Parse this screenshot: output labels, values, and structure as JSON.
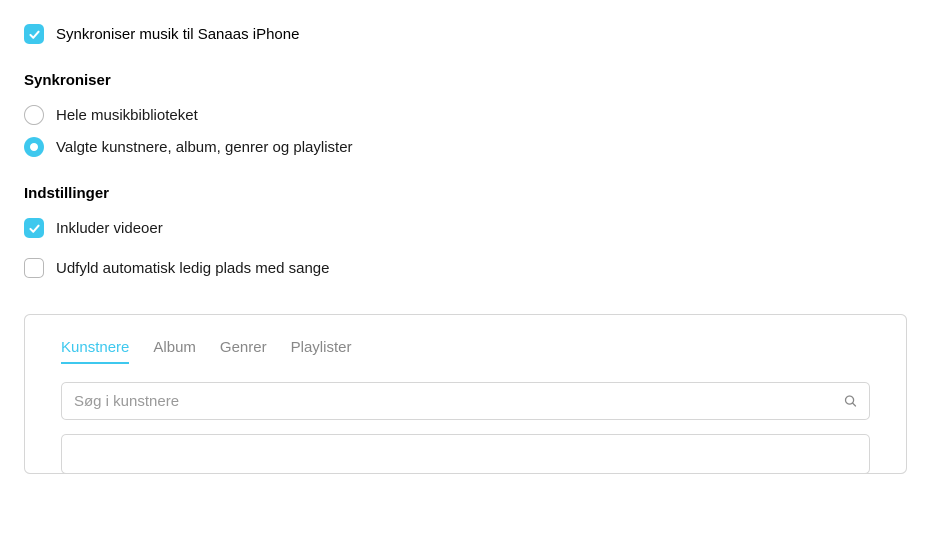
{
  "syncMusic": {
    "label": "Synkroniser musik til Sanaas iPhone",
    "checked": true
  },
  "sections": {
    "synchronize": {
      "title": "Synkroniser",
      "options": {
        "entireLibrary": {
          "label": "Hele musikbiblioteket",
          "selected": false
        },
        "selected": {
          "label": "Valgte kunstnere, album, genrer og playlister",
          "selected": true
        }
      }
    },
    "settings": {
      "title": "Indstillinger",
      "includeVideos": {
        "label": "Inkluder videoer",
        "checked": true
      },
      "autofill": {
        "label": "Udfyld automatisk ledig plads med sange",
        "checked": false
      }
    }
  },
  "contentPanel": {
    "tabs": [
      {
        "label": "Kunstnere",
        "active": true
      },
      {
        "label": "Album",
        "active": false
      },
      {
        "label": "Genrer",
        "active": false
      },
      {
        "label": "Playlister",
        "active": false
      }
    ],
    "search": {
      "placeholder": "Søg i kunstnere"
    }
  }
}
